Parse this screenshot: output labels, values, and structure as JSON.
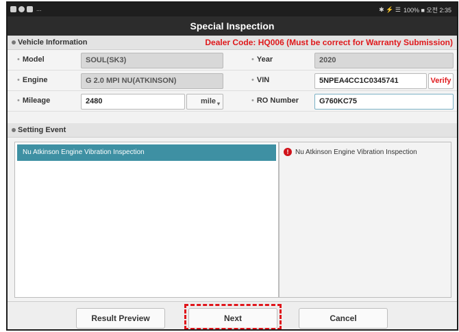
{
  "status_bar": {
    "left_dots": "...",
    "right_text": "100% ■ 오전 2:35",
    "indicators": "✱ ⚡ ☰"
  },
  "title": "Special Inspection",
  "vehicle_info": {
    "section_label": "Vehicle Information",
    "dealer_notice": "Dealer Code: HQ006  (Must be correct for Warranty Submission)",
    "model": {
      "label": "Model",
      "value": "SOUL(SK3)"
    },
    "engine": {
      "label": "Engine",
      "value": "G 2.0 MPI NU(ATKINSON)"
    },
    "mileage": {
      "label": "Mileage",
      "value": "2480",
      "unit": "mile"
    },
    "year": {
      "label": "Year",
      "value": "2020"
    },
    "vin": {
      "label": "VIN",
      "value": "5NPEA4CC1C0345741",
      "verify_label": "Verify"
    },
    "ro_number": {
      "label": "RO Number",
      "value": "G760KC75"
    }
  },
  "setting_event": {
    "section_label": "Setting Event",
    "selected_item": "Nu Atkinson Engine Vibration Inspection",
    "description": "Nu Atkinson Engine Vibration Inspection"
  },
  "footer": {
    "result_preview_label": "Result Preview",
    "next_label": "Next",
    "cancel_label": "Cancel"
  },
  "colors": {
    "accent": "#3e90a3",
    "alert_red": "#e0181b",
    "title_bar": "#2c2c2c"
  }
}
